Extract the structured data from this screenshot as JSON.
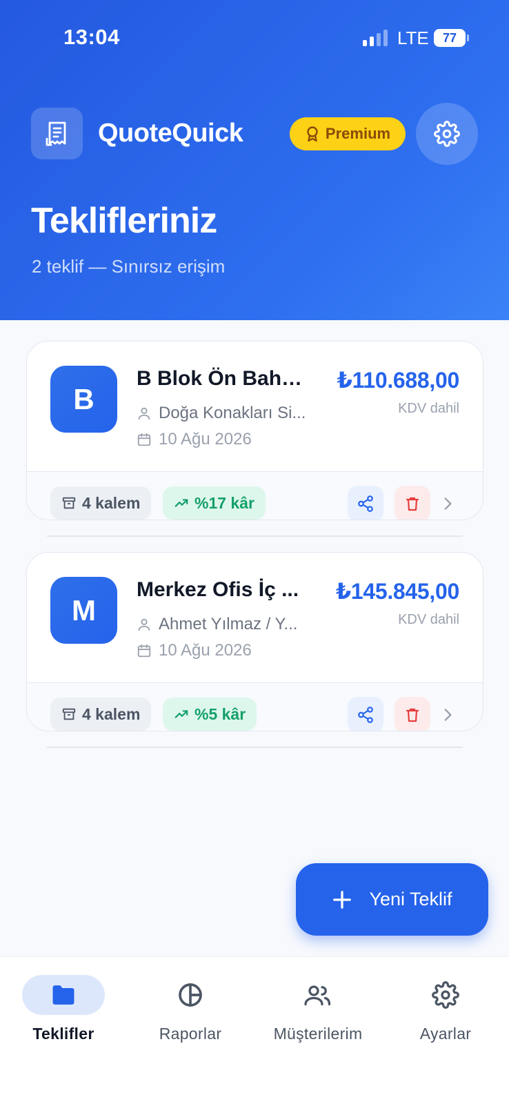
{
  "status": {
    "time": "13:04",
    "network": "LTE",
    "battery": "77"
  },
  "header": {
    "app_name": "QuoteQuick",
    "premium_label": "Premium",
    "title": "Teklifleriniz",
    "subtitle": "2 teklif — Sınırsız erişim"
  },
  "quotes": [
    {
      "initial": "B",
      "title": "B Blok Ön Bahç...",
      "client": "Doğa Konakları Si...",
      "date": "10 Ağu 2026",
      "amount": "₺110.688,00",
      "vat": "KDV dahil",
      "items": "4 kalem",
      "profit": "%17 kâr"
    },
    {
      "initial": "M",
      "title": "Merkez Ofis İç ...",
      "client": "Ahmet Yılmaz / Y...",
      "date": "10 Ağu 2026",
      "amount": "₺145.845,00",
      "vat": "KDV dahil",
      "items": "4 kalem",
      "profit": "%5 kâr"
    }
  ],
  "fab": {
    "label": "Yeni Teklif"
  },
  "nav": {
    "items": [
      {
        "label": "Teklifler",
        "icon": "folder-icon",
        "active": true
      },
      {
        "label": "Raporlar",
        "icon": "pie-chart-icon",
        "active": false
      },
      {
        "label": "Müşterilerim",
        "icon": "users-icon",
        "active": false
      },
      {
        "label": "Ayarlar",
        "icon": "gear-icon",
        "active": false
      }
    ]
  },
  "colors": {
    "primary": "#2563eb",
    "header_start": "#2459df",
    "premium": "#fcd116",
    "profit": "#14a06a",
    "delete": "#e53e3e"
  }
}
